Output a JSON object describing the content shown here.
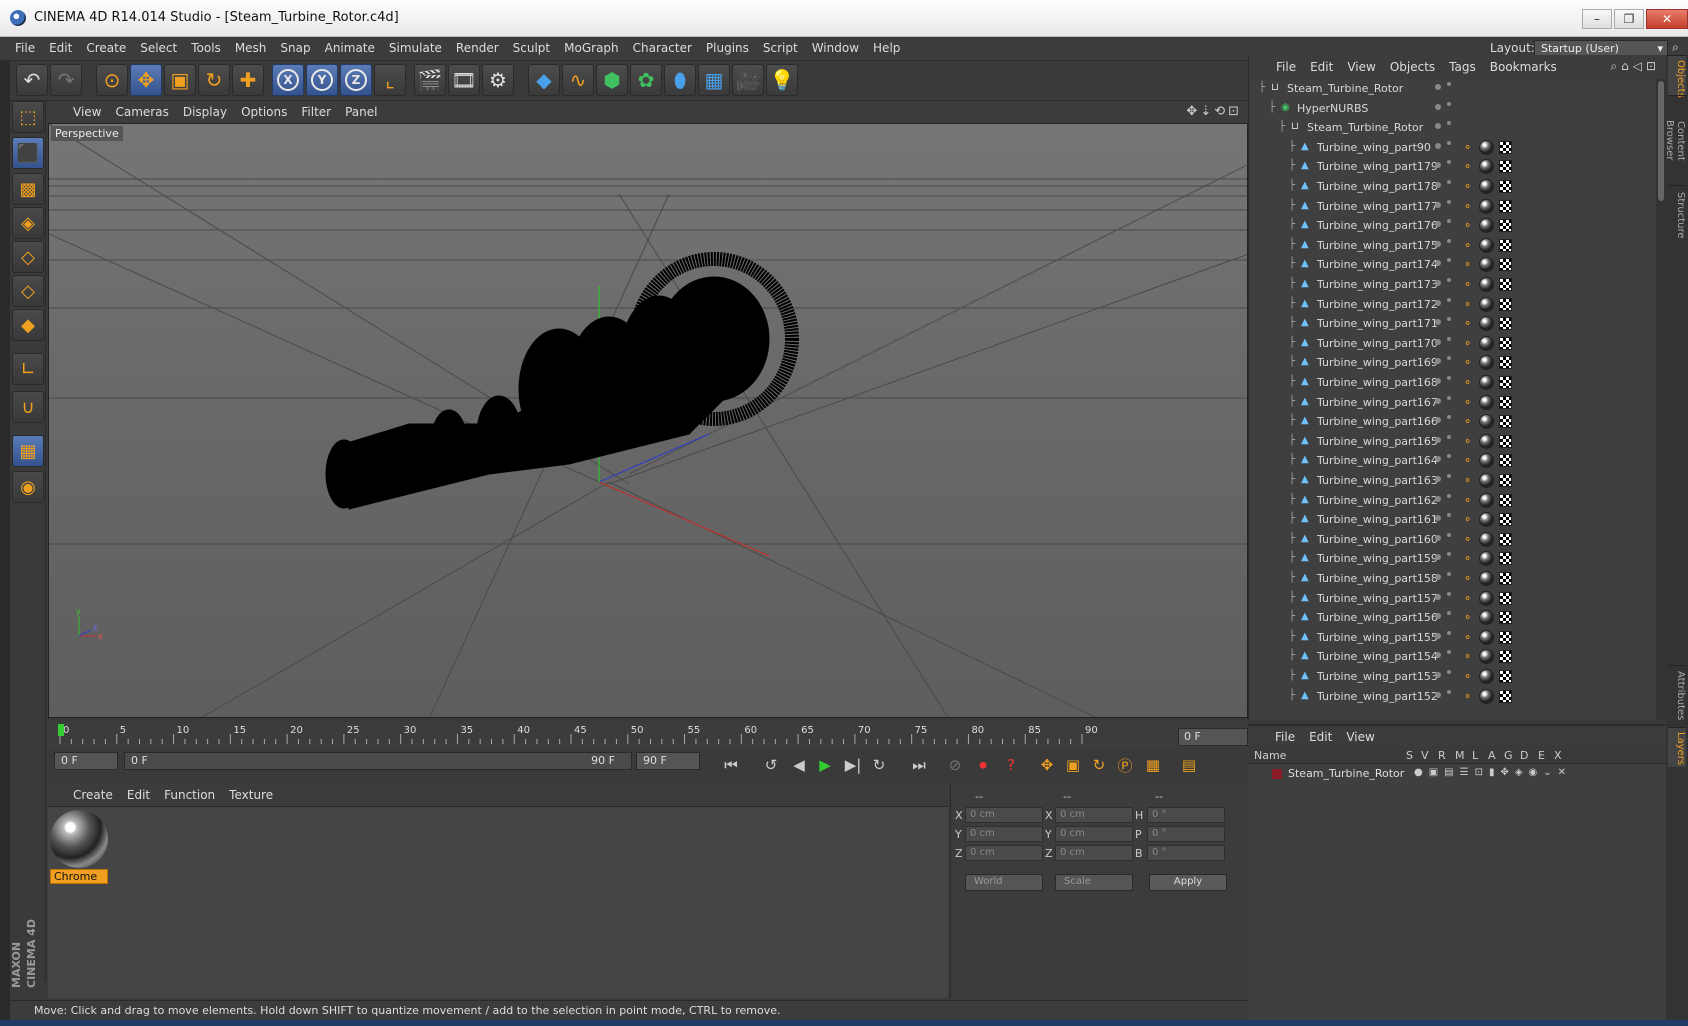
{
  "window": {
    "title": "CINEMA 4D R14.014 Studio - [Steam_Turbine_Rotor.c4d]",
    "buttons": [
      "–",
      "❐",
      "✕"
    ]
  },
  "menubar": {
    "items": [
      "File",
      "Edit",
      "Create",
      "Select",
      "Tools",
      "Mesh",
      "Snap",
      "Animate",
      "Simulate",
      "Render",
      "Sculpt",
      "MoGraph",
      "Character",
      "Plugins",
      "Script",
      "Window",
      "Help"
    ],
    "layout_label": "Layout:",
    "layout_value": "Startup (User)"
  },
  "viewport": {
    "menu": [
      "View",
      "Cameras",
      "Display",
      "Options",
      "Filter",
      "Panel"
    ],
    "label": "Perspective",
    "axis_labels": [
      "y",
      "z",
      "x"
    ]
  },
  "timeline": {
    "ticks": [
      "0",
      "5",
      "10",
      "15",
      "20",
      "25",
      "30",
      "35",
      "40",
      "45",
      "50",
      "55",
      "60",
      "65",
      "70",
      "75",
      "80",
      "85",
      "90"
    ],
    "frame_display": "0 F",
    "start_field": "0 F",
    "range_start": "0 F",
    "range_end": "90 F",
    "end_field": "90 F"
  },
  "material_manager": {
    "menu": [
      "Create",
      "Edit",
      "Function",
      "Texture"
    ],
    "materials": [
      {
        "name": "Chrome"
      }
    ]
  },
  "coordinates": {
    "headers": [
      "--",
      "--",
      "--"
    ],
    "rows": [
      {
        "l1": "X",
        "v1": "0 cm",
        "l2": "X",
        "v2": "0 cm",
        "l3": "H",
        "v3": "0 °"
      },
      {
        "l1": "Y",
        "v1": "0 cm",
        "l2": "Y",
        "v2": "0 cm",
        "l3": "P",
        "v3": "0 °"
      },
      {
        "l1": "Z",
        "v1": "0 cm",
        "l2": "Z",
        "v2": "0 cm",
        "l3": "B",
        "v3": "0 °"
      }
    ],
    "mode1": "World",
    "mode2": "Scale",
    "apply": "Apply"
  },
  "status": "Move: Click and drag to move elements. Hold down SHIFT to quantize movement / add to the selection in point mode, CTRL to remove.",
  "object_manager": {
    "menu": [
      "File",
      "Edit",
      "View",
      "Objects",
      "Tags",
      "Bookmarks"
    ],
    "root": "Steam_Turbine_Rotor",
    "hypernurbs": "HyperNURBS",
    "child": "Steam_Turbine_Rotor",
    "parts": [
      "Turbine_wing_part90",
      "Turbine_wing_part179",
      "Turbine_wing_part178",
      "Turbine_wing_part177",
      "Turbine_wing_part176",
      "Turbine_wing_part175",
      "Turbine_wing_part174",
      "Turbine_wing_part173",
      "Turbine_wing_part172",
      "Turbine_wing_part171",
      "Turbine_wing_part170",
      "Turbine_wing_part169",
      "Turbine_wing_part168",
      "Turbine_wing_part167",
      "Turbine_wing_part166",
      "Turbine_wing_part165",
      "Turbine_wing_part164",
      "Turbine_wing_part163",
      "Turbine_wing_part162",
      "Turbine_wing_part161",
      "Turbine_wing_part160",
      "Turbine_wing_part159",
      "Turbine_wing_part158",
      "Turbine_wing_part157",
      "Turbine_wing_part156",
      "Turbine_wing_part155",
      "Turbine_wing_part154",
      "Turbine_wing_part153",
      "Turbine_wing_part152"
    ]
  },
  "layer_manager": {
    "menu": [
      "File",
      "Edit",
      "View"
    ],
    "columns": [
      "Name",
      "S",
      "V",
      "R",
      "M",
      "L",
      "A",
      "G",
      "D",
      "E",
      "X"
    ],
    "layers": [
      "Steam_Turbine_Rotor"
    ]
  },
  "right_tabs": [
    "Objects",
    "Content Browser",
    "Structure",
    "Attributes",
    "Layers"
  ],
  "logo": {
    "brand": "MAXON",
    "product": "CINEMA 4D"
  },
  "colors": {
    "accent": "#f0a020",
    "active_blue": "#34528c",
    "x_axis": "#c03030",
    "y_axis": "#30c030",
    "z_axis": "#3040c0"
  }
}
